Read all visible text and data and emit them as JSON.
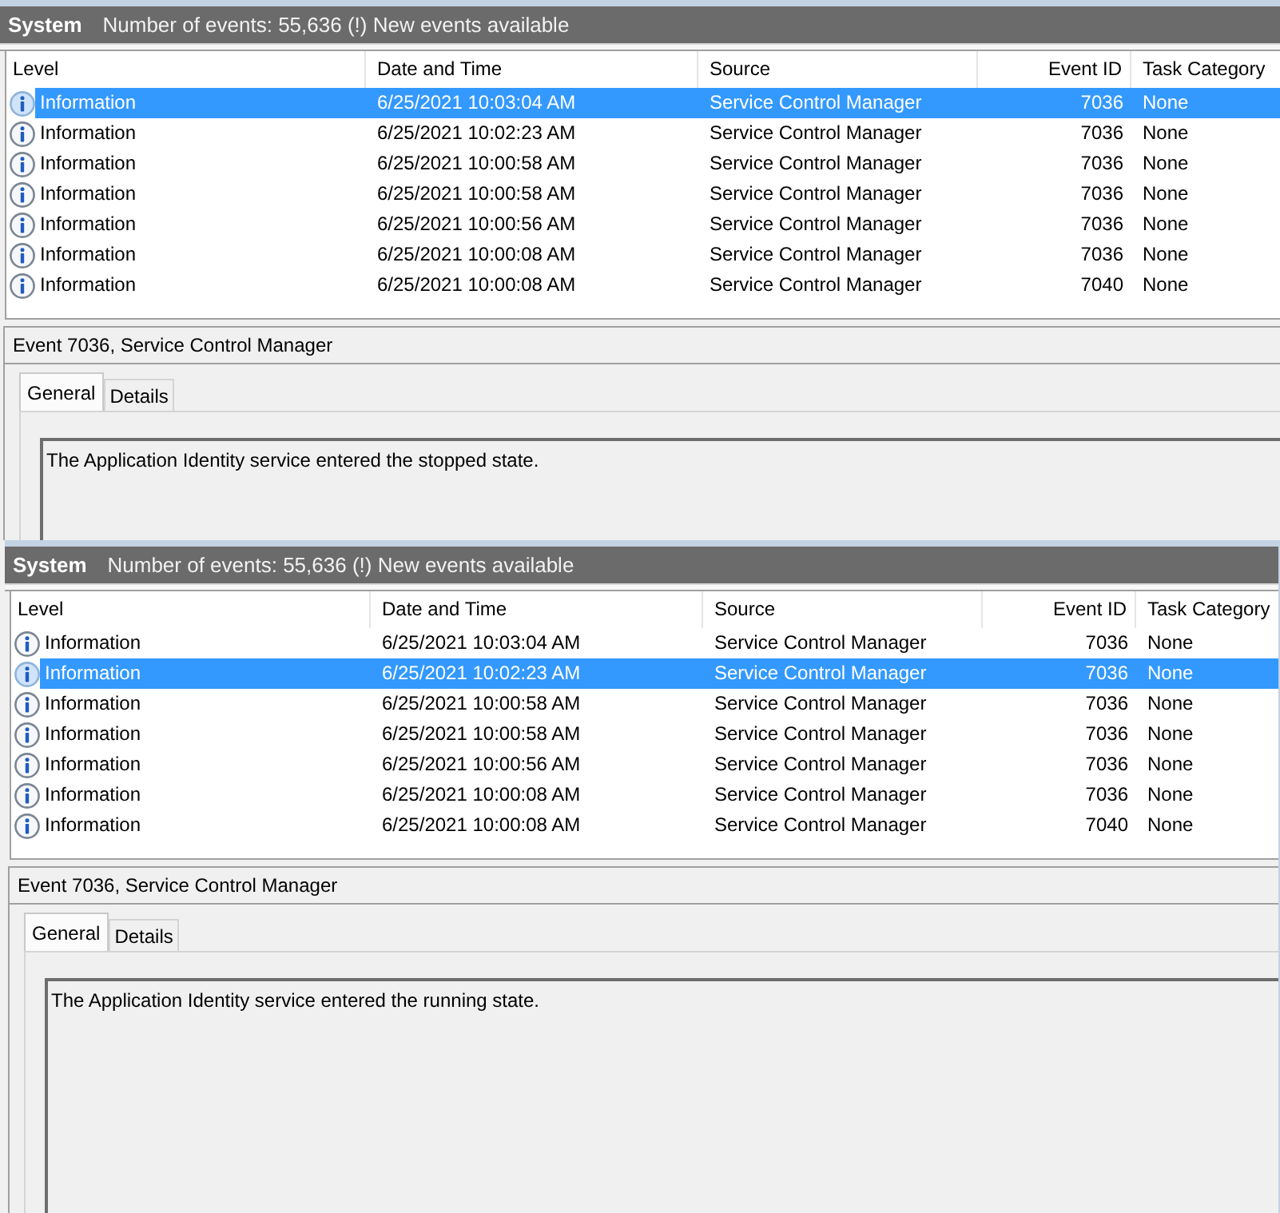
{
  "panels": [
    {
      "header": {
        "title": "System",
        "summary": "Number of events: 55,636 (!) New events available"
      },
      "table": {
        "columns": [
          "Level",
          "Date and Time",
          "Source",
          "Event ID",
          "Task Category"
        ],
        "rows": [
          {
            "level": "Information",
            "date_time": "6/25/2021 10:03:04 AM",
            "source": "Service Control Manager",
            "event_id": "7036",
            "task_category": "None",
            "selected": true
          },
          {
            "level": "Information",
            "date_time": "6/25/2021 10:02:23 AM",
            "source": "Service Control Manager",
            "event_id": "7036",
            "task_category": "None",
            "selected": false
          },
          {
            "level": "Information",
            "date_time": "6/25/2021 10:00:58 AM",
            "source": "Service Control Manager",
            "event_id": "7036",
            "task_category": "None",
            "selected": false
          },
          {
            "level": "Information",
            "date_time": "6/25/2021 10:00:58 AM",
            "source": "Service Control Manager",
            "event_id": "7036",
            "task_category": "None",
            "selected": false
          },
          {
            "level": "Information",
            "date_time": "6/25/2021 10:00:56 AM",
            "source": "Service Control Manager",
            "event_id": "7036",
            "task_category": "None",
            "selected": false
          },
          {
            "level": "Information",
            "date_time": "6/25/2021 10:00:08 AM",
            "source": "Service Control Manager",
            "event_id": "7036",
            "task_category": "None",
            "selected": false
          },
          {
            "level": "Information",
            "date_time": "6/25/2021 10:00:08 AM",
            "source": "Service Control Manager",
            "event_id": "7040",
            "task_category": "None",
            "selected": false
          }
        ]
      },
      "detail": {
        "title": "Event 7036, Service Control Manager",
        "tabs": [
          {
            "label": "General",
            "selected": true
          },
          {
            "label": "Details",
            "selected": false
          }
        ],
        "message": "The Application Identity service entered the stopped state."
      }
    },
    {
      "header": {
        "title": "System",
        "summary": "Number of events: 55,636 (!) New events available"
      },
      "table": {
        "columns": [
          "Level",
          "Date and Time",
          "Source",
          "Event ID",
          "Task Category"
        ],
        "rows": [
          {
            "level": "Information",
            "date_time": "6/25/2021 10:03:04 AM",
            "source": "Service Control Manager",
            "event_id": "7036",
            "task_category": "None",
            "selected": false
          },
          {
            "level": "Information",
            "date_time": "6/25/2021 10:02:23 AM",
            "source": "Service Control Manager",
            "event_id": "7036",
            "task_category": "None",
            "selected": true
          },
          {
            "level": "Information",
            "date_time": "6/25/2021 10:00:58 AM",
            "source": "Service Control Manager",
            "event_id": "7036",
            "task_category": "None",
            "selected": false
          },
          {
            "level": "Information",
            "date_time": "6/25/2021 10:00:58 AM",
            "source": "Service Control Manager",
            "event_id": "7036",
            "task_category": "None",
            "selected": false
          },
          {
            "level": "Information",
            "date_time": "6/25/2021 10:00:56 AM",
            "source": "Service Control Manager",
            "event_id": "7036",
            "task_category": "None",
            "selected": false
          },
          {
            "level": "Information",
            "date_time": "6/25/2021 10:00:08 AM",
            "source": "Service Control Manager",
            "event_id": "7036",
            "task_category": "None",
            "selected": false
          },
          {
            "level": "Information",
            "date_time": "6/25/2021 10:00:08 AM",
            "source": "Service Control Manager",
            "event_id": "7040",
            "task_category": "None",
            "selected": false
          }
        ]
      },
      "detail": {
        "title": "Event 7036, Service Control Manager",
        "tabs": [
          {
            "label": "General",
            "selected": true
          },
          {
            "label": "Details",
            "selected": false
          }
        ],
        "message": "The Application Identity service entered the running state."
      }
    }
  ]
}
